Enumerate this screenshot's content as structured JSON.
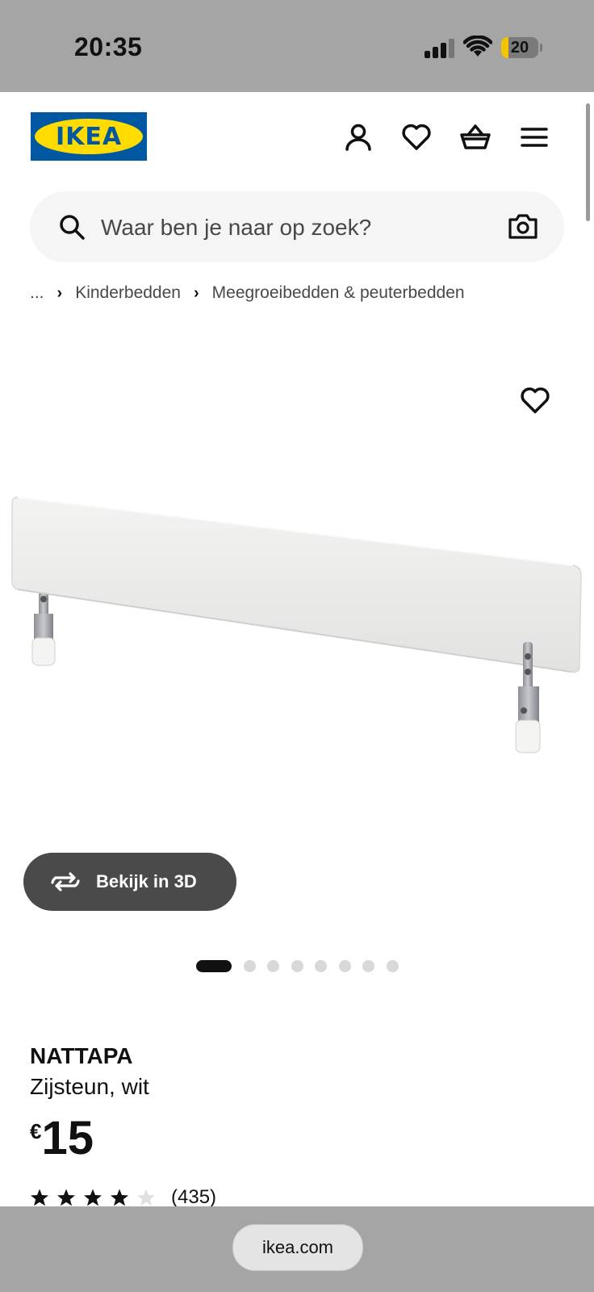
{
  "status_bar": {
    "time": "20:35",
    "battery": "20",
    "battery_level": 0.2
  },
  "header": {
    "logo_text": "IKEA",
    "icons": [
      "profile-icon",
      "heart-icon",
      "basket-icon",
      "menu-icon"
    ]
  },
  "search": {
    "placeholder": "Waar ben je naar op zoek?",
    "icon": "search-icon",
    "camera_icon": "camera-icon"
  },
  "breadcrumb": {
    "ellipsis": "...",
    "items": [
      "Kinderbedden",
      "Meegroeibedden & peuterbedden"
    ]
  },
  "gallery": {
    "button_label": "Bekijk in 3D",
    "dots_total": 8,
    "active_dot": 1
  },
  "product": {
    "name": "NATTAPA",
    "description": "Zijsteun, wit",
    "currency": "€",
    "price": "15",
    "rating_value": 4,
    "rating_max": 5,
    "review_count": "(435)"
  },
  "browser": {
    "url": "ikea.com"
  },
  "colors": {
    "brand_blue": "#0058a3",
    "brand_yellow": "#ffdb00",
    "chrome_gray": "#a5a5a5",
    "button_dark": "#4a4a4a"
  }
}
